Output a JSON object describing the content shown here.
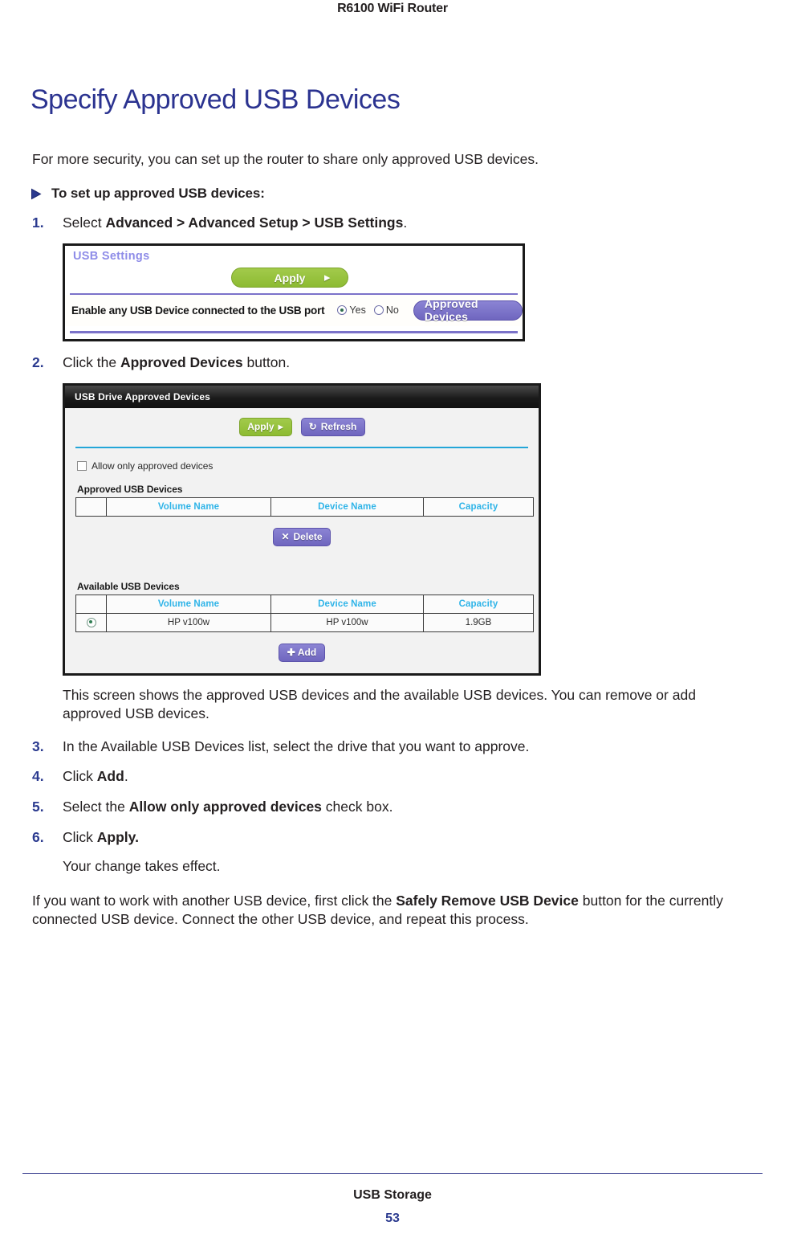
{
  "header": {
    "running_title": "R6100 WiFi Router"
  },
  "section": {
    "title": "Specify Approved USB Devices",
    "intro": "For more security, you can set up the router to share only approved USB devices.",
    "procedure_heading": "To set up approved USB devices:"
  },
  "steps": [
    {
      "num": "1.",
      "prefix": "Select ",
      "bold": "Advanced > Advanced Setup > USB Settings",
      "suffix": "."
    },
    {
      "num": "2.",
      "prefix": "Click the ",
      "bold": "Approved Devices",
      "suffix": " button."
    },
    {
      "num": "3.",
      "prefix": "In the Available USB Devices list, select the drive that you want to approve.",
      "bold": "",
      "suffix": ""
    },
    {
      "num": "4.",
      "prefix": "Click ",
      "bold": "Add",
      "suffix": "."
    },
    {
      "num": "5.",
      "prefix": "Select the ",
      "bold": "Allow only approved devices",
      "suffix": " check box."
    },
    {
      "num": "6.",
      "prefix": "Click ",
      "bold": "Apply.",
      "suffix": ""
    }
  ],
  "paragraphs": {
    "after_fig2": "This screen shows the approved USB devices and the available USB devices. You can remove or add approved USB devices.",
    "after_step6": "Your change takes effect.",
    "closing_prefix": "If you want to work with another USB device, first click the ",
    "closing_bold": "Safely Remove USB Device",
    "closing_suffix": " button for the currently connected USB device. Connect the other USB device, and repeat this process."
  },
  "figure_usb_settings": {
    "panel_title": "USB Settings",
    "apply_label": "Apply",
    "apply_caret": "▶",
    "setting_label": "Enable any USB Device connected to the USB port",
    "radio_yes": "Yes",
    "radio_no": "No",
    "radio_selected": "Yes",
    "approved_devices_label": "Approved Devices",
    "colors": {
      "panel_title": "#8e8ce8",
      "rule": "#7b72c9",
      "apply_button": "#8dbb32",
      "approved_button": "#6f66bf"
    }
  },
  "figure_approved_devices": {
    "panel_title": "USB Drive Approved Devices",
    "apply_label": "Apply",
    "apply_caret": "▶",
    "refresh_label": "Refresh",
    "refresh_icon": "↻",
    "checkbox_label": "Allow only approved devices",
    "checkbox_checked": false,
    "approved_section_label": "Approved USB Devices",
    "available_section_label": "Available USB Devices",
    "table_headers": [
      "",
      "Volume Name",
      "Device Name",
      "Capacity"
    ],
    "approved_rows": [],
    "available_rows": [
      {
        "selected": true,
        "volume_name": "HP v100w",
        "device_name": "HP v100w",
        "capacity": "1.9GB"
      }
    ],
    "delete_label": "Delete",
    "delete_icon": "✕",
    "add_label": "Add",
    "add_icon": "✚",
    "colors": {
      "titlebar": "#1b1b1b",
      "rule": "#24a6d8",
      "table_header_text": "#2fb4e8",
      "apply_button": "#8dbb32",
      "purple_button": "#6f66bf"
    }
  },
  "footer": {
    "chapter": "USB Storage",
    "page_number": "53"
  }
}
